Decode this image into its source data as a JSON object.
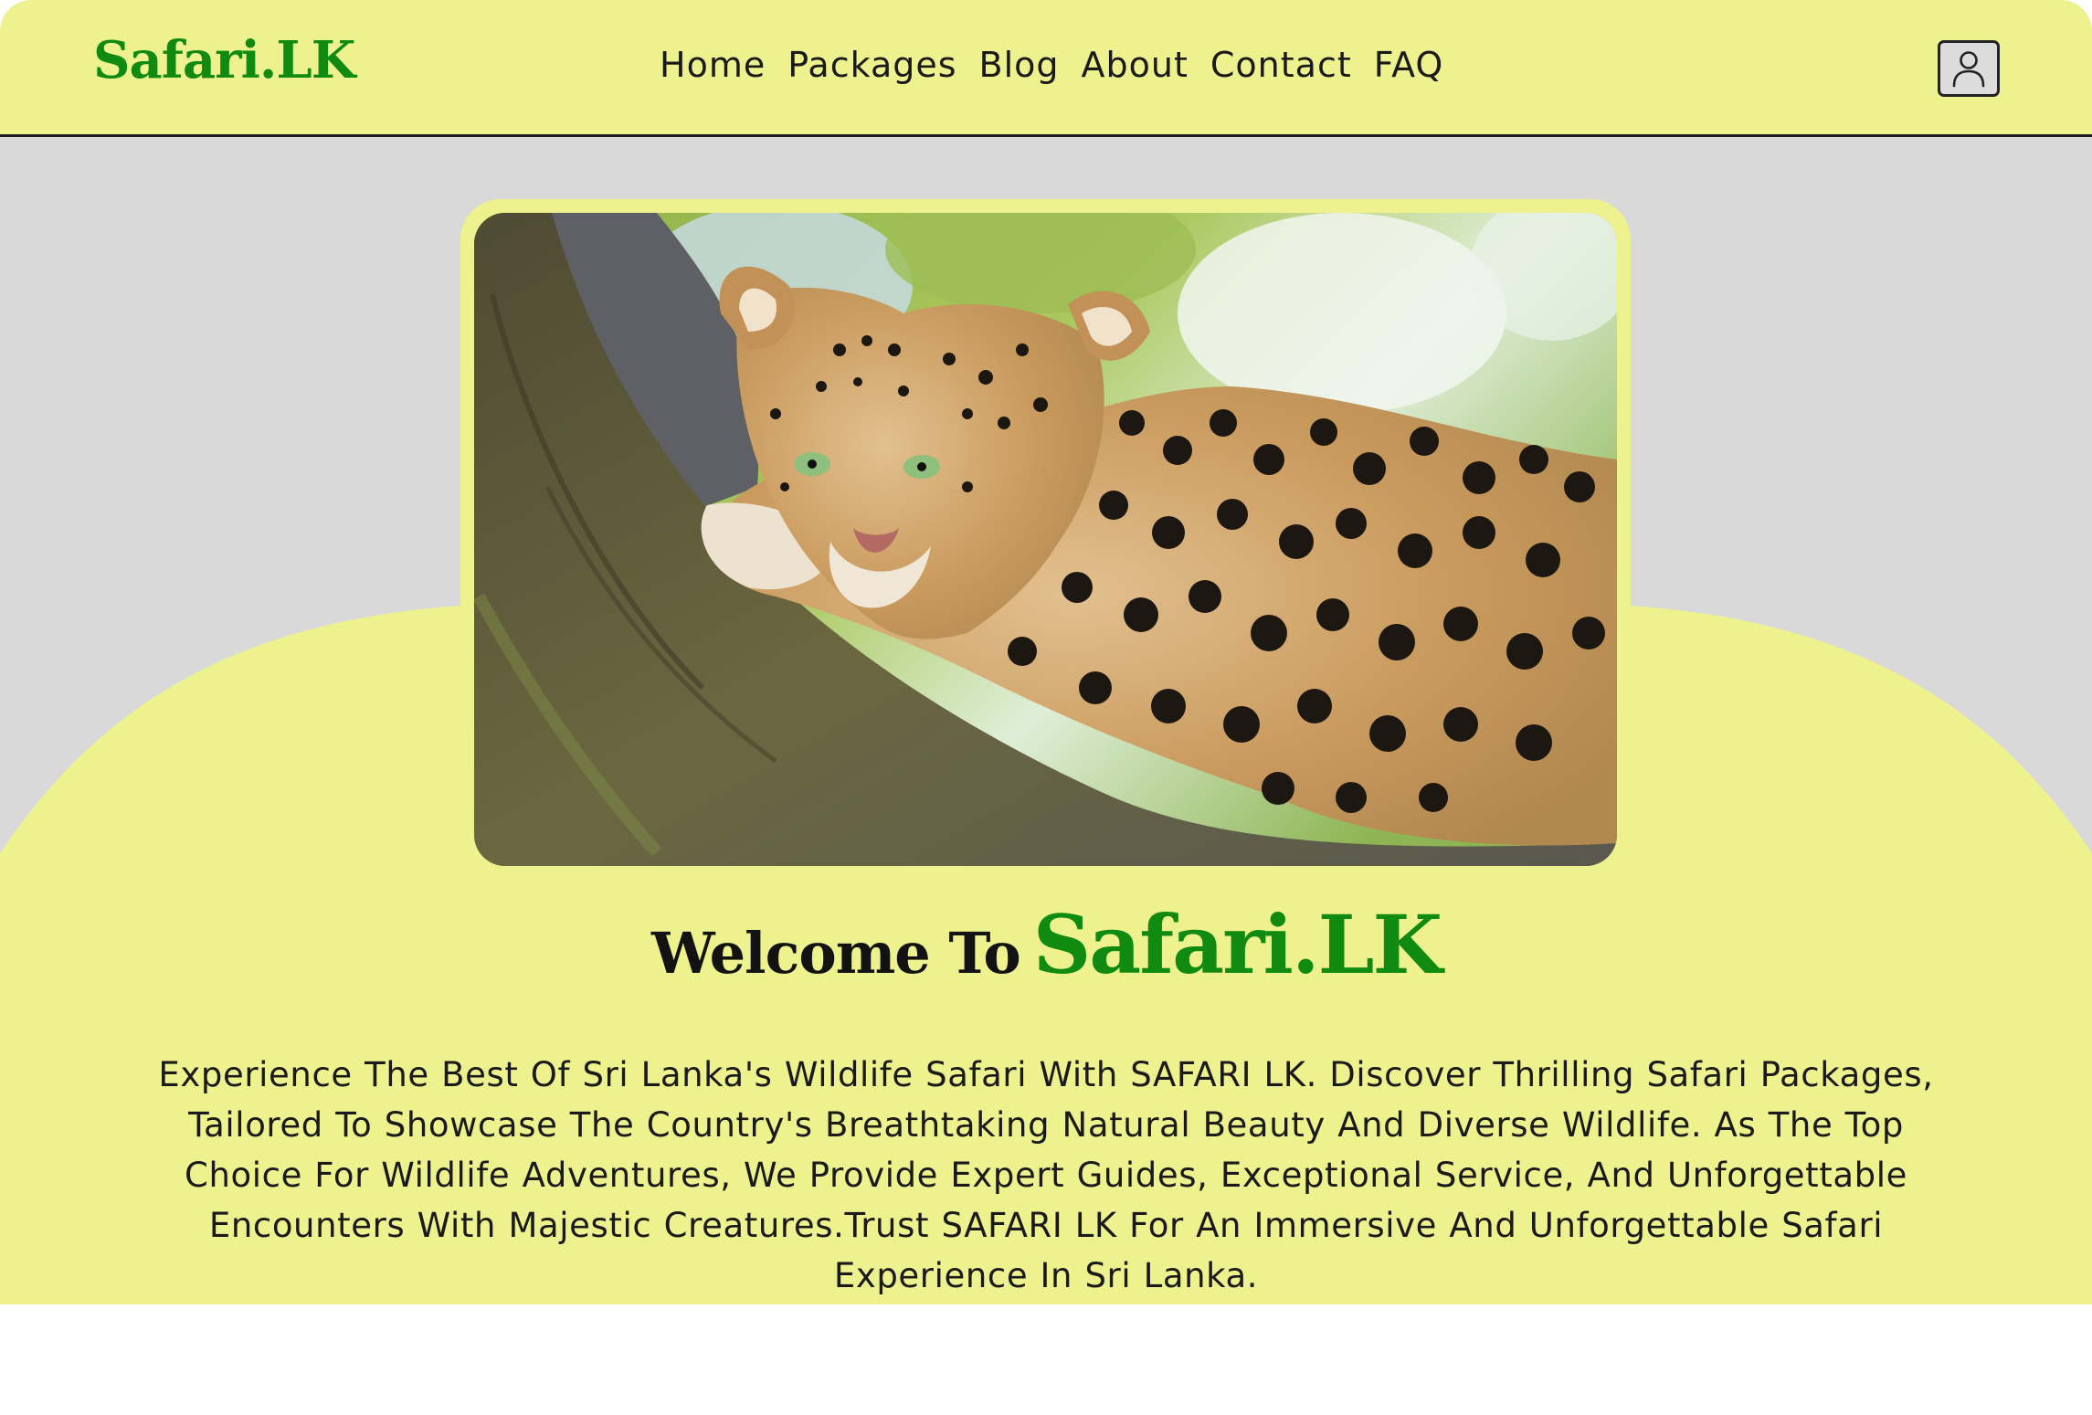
{
  "header": {
    "logo": "Safari.LK",
    "nav": [
      "Home",
      "Packages",
      "Blog",
      "About",
      "Contact",
      "FAQ"
    ],
    "user_icon": "user-icon"
  },
  "hero": {
    "image_alt": "leopard-resting-on-tree-branch",
    "welcome_prefix": "Welcome To",
    "welcome_brand": "Safari.LK",
    "description": "Experience The Best Of Sri Lanka's Wildlife Safari With SAFARI LK. Discover Thrilling Safari Packages, Tailored To Showcase The Country's Breathtaking Natural Beauty And Diverse Wildlife. As The Top Choice For Wildlife Adventures, We Provide Expert Guides, Exceptional Service, And Unforgettable Encounters With Majestic Creatures.Trust SAFARI LK For An Immersive And Unforgettable Safari Experience In Sri Lanka."
  },
  "colors": {
    "accent": "#edf28e",
    "brand_green": "#118a11",
    "hero_gray": "#d9d9d9"
  }
}
